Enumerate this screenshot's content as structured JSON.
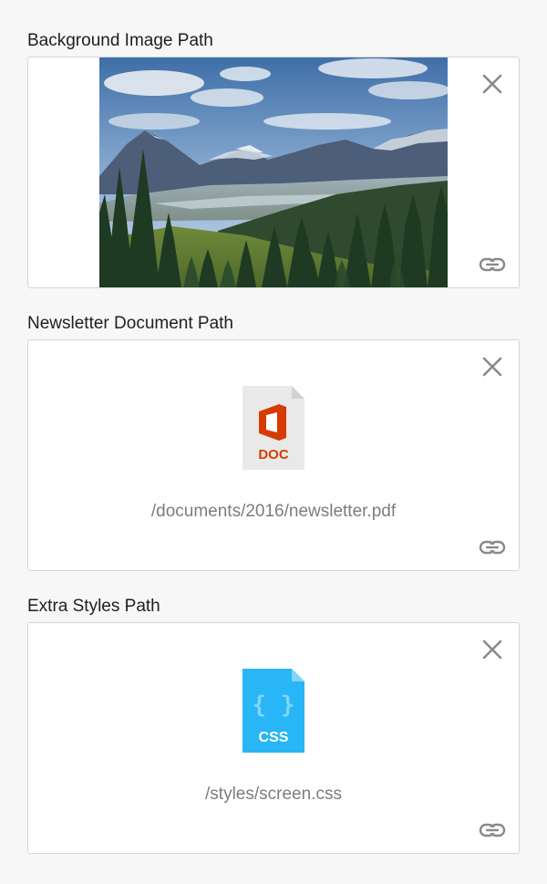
{
  "fields": [
    {
      "label": "Background Image Path",
      "kind": "image",
      "preview_icon": "mountain-landscape-photo",
      "remove_icon": "close-icon",
      "link_icon": "link-icon"
    },
    {
      "label": "Newsletter Document Path",
      "kind": "document",
      "file_type": "DOC",
      "file_icon": "office-doc-file-icon",
      "file_color": "#d83b01",
      "path": "/documents/2016/newsletter.pdf",
      "remove_icon": "close-icon",
      "link_icon": "link-icon"
    },
    {
      "label": "Extra Styles Path",
      "kind": "stylesheet",
      "file_type": "CSS",
      "file_icon": "css-file-icon",
      "file_color": "#29b6f6",
      "path": "/styles/screen.css",
      "remove_icon": "close-icon",
      "link_icon": "link-icon"
    }
  ],
  "colors": {
    "background": "#f7f7f7",
    "box_border": "#d6d6d6",
    "icon_gray": "#8a8a8a",
    "path_text": "#7d7d7d"
  }
}
